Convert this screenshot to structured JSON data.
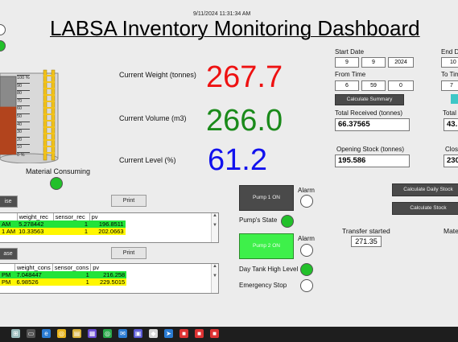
{
  "header": {
    "timestamp": "9/11/2024 11:31:34 AM",
    "title": "LABSA Inventory Monitoring Dashboard"
  },
  "tank": {
    "scale_labels": [
      "100 %",
      "90",
      "80",
      "70",
      "60",
      "50",
      "40",
      "30",
      "20",
      "10",
      "0 %"
    ],
    "level_fraction": 0.612,
    "fill_color": "#b2441d",
    "caption": "Material Consuming"
  },
  "metrics": {
    "weight": {
      "label": "Current Weight (tonnes)",
      "value": "267.7",
      "color": "#ee1111"
    },
    "volume": {
      "label": "Current Volume (m3)",
      "value": "266.0",
      "color": "#1a8a1a"
    },
    "level": {
      "label": "Current Level (%)",
      "value": "61.2",
      "color": "#1111ee"
    }
  },
  "tables": {
    "received": {
      "left_button": "ise",
      "print_button": "Print",
      "headers": [
        "",
        "weight_rec",
        "sensor_rec",
        "pv"
      ],
      "rows": [
        {
          "t": "AM",
          "weight": "5.278442",
          "sensor": "1",
          "pv": "196.8511",
          "color": "green"
        },
        {
          "t": "1 AM",
          "weight": "10.33563",
          "sensor": "1",
          "pv": "202.0663",
          "color": "yellow"
        }
      ]
    },
    "consumed": {
      "left_button": "ase",
      "print_button": "Print",
      "headers": [
        "",
        "weight_cons",
        "sensor_cons",
        "pv"
      ],
      "rows": [
        {
          "t": "PM",
          "weight": "7.048447",
          "sensor": "1",
          "pv": "216.258",
          "color": "green"
        },
        {
          "t": "PM",
          "weight": "6.98526",
          "sensor": "1",
          "pv": "229.5015",
          "color": "yellow"
        }
      ]
    }
  },
  "pumps": {
    "pump1_label": "Pump 1 ON",
    "pump2_label": "Pump 2 ON",
    "alarm_label": "Alarm",
    "pump_state_label": "Pump's State",
    "day_tank_label": "Day Tank High Level",
    "emergency_label": "Emergency Stop"
  },
  "summary": {
    "start_date_label": "Start Date",
    "start_day": "9",
    "start_month": "9",
    "start_year": "2024",
    "from_time_label": "From Time",
    "from_h": "6",
    "from_m": "59",
    "from_s": "0",
    "calc_summary": "Calculate Summary",
    "total_received_label": "Total Received (tonnes)",
    "total_received": "66.37565",
    "opening_stock_label": "Opening Stock (tonnes)",
    "opening_stock": "195.586",
    "end_date_label": "End D",
    "end_day": "10",
    "to_time_label": "To Tim",
    "to_h": "7",
    "total_cons_label": "Total",
    "total_cons": "43.",
    "closing_label": "Clos",
    "closing": "230",
    "calc_daily": "Calculate Daily Stock",
    "calc_stock": "Calculate Stock",
    "transfer_label": "Transfer started",
    "transfer_value": "271.35",
    "material_label": "Mate"
  },
  "taskbar": {
    "icons": [
      "start-icon",
      "task-view-icon",
      "edge-icon",
      "chrome-icon",
      "explorer-icon",
      "store-icon",
      "chrome-alt-icon",
      "mail-icon",
      "teams-icon",
      "labview-icon",
      "arrow-icon",
      "app1-icon",
      "app2-icon",
      "app3-icon"
    ]
  }
}
